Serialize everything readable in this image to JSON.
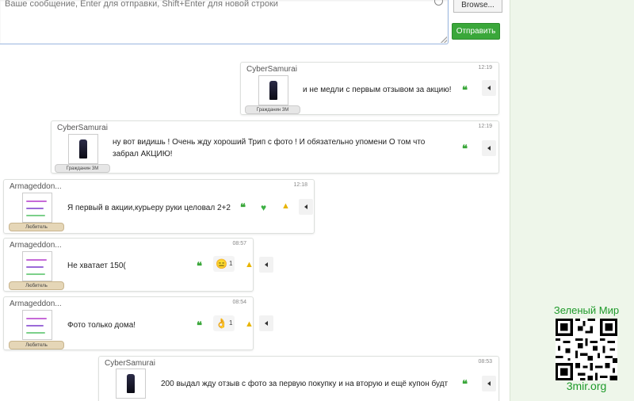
{
  "composer": {
    "placeholder": "Ваше сообщение, Enter для отправки, Shift+Enter для новой строки",
    "browse_label": "Browse...",
    "send_label": "Отправить"
  },
  "messages": [
    {
      "author": "CyberSamurai",
      "time": "12:19",
      "rank": "Гражданин 3М",
      "text": "и не медли с первым отзывом за акцию!",
      "quote_icon": "quote-icon",
      "arrow_icon": "arrow-left-icon"
    },
    {
      "author": "CyberSamurai",
      "time": "12:19",
      "rank": "Гражданин 3М",
      "text": "ну вот видишь ! Очень жду хороший Трип с фото ! И обязательно упомени О том что забрал АКЦИЮ!",
      "quote_icon": "quote-icon",
      "arrow_icon": "arrow-left-icon"
    },
    {
      "author": "Armageddon...",
      "time": "12:18",
      "rank": "Любитель",
      "text": "Я первый в акции,курьеру руки целовал 2+2",
      "quote_icon": "quote-icon",
      "like_icon": "green-heart-icon",
      "warn_icon": "warning-icon",
      "arrow_icon": "arrow-left-icon"
    },
    {
      "author": "Armageddon...",
      "time": "08:57",
      "rank": "Любитель",
      "text": "Не хватает 150(",
      "quote_icon": "quote-icon",
      "reaction": {
        "emoji": "😑",
        "count": "1"
      },
      "warn_icon": "warning-icon",
      "arrow_icon": "arrow-left-icon"
    },
    {
      "author": "Armageddon...",
      "time": "08:54",
      "rank": "Любитель",
      "text": "Фото только дома!",
      "quote_icon": "quote-icon",
      "reaction": {
        "emoji": "👌",
        "count": "1"
      },
      "warn_icon": "warning-icon",
      "arrow_icon": "arrow-left-icon"
    },
    {
      "author": "CyberSamurai",
      "time": "08:53",
      "rank": "",
      "text": "200 выдал жду отзыв с фото за первую покупку и на вторую и ещё купон будт",
      "quote_icon": "quote-icon",
      "arrow_icon": "arrow-left-icon"
    }
  ],
  "brand": {
    "title": "Зеленый Мир",
    "url": "3mir.org",
    "accent": "#1e9a2a",
    "qr_icon": "qr-code-icon"
  },
  "colors": {
    "send_button": "#3aa73a",
    "quote": "#3aa73a",
    "warning": "#e8b400",
    "panel_bg": "#eef6ea"
  }
}
